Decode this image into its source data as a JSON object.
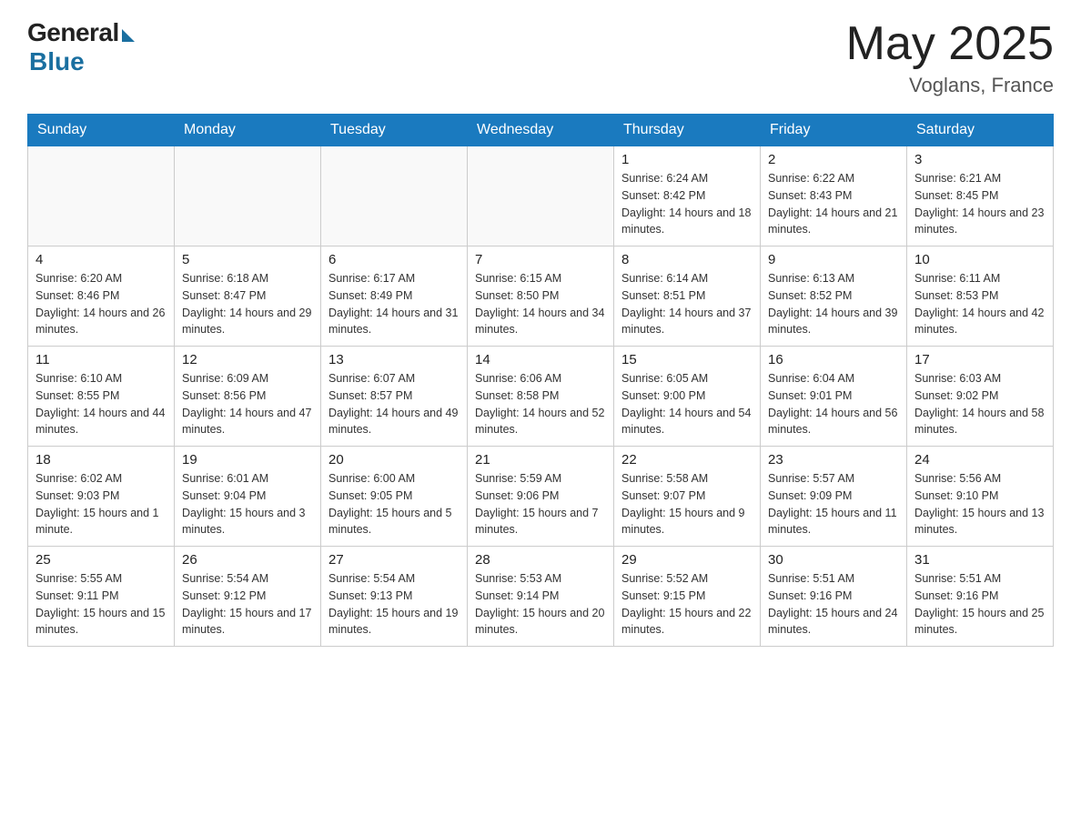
{
  "header": {
    "logo_general": "General",
    "logo_blue": "Blue",
    "month_year": "May 2025",
    "location": "Voglans, France"
  },
  "days_of_week": [
    "Sunday",
    "Monday",
    "Tuesday",
    "Wednesday",
    "Thursday",
    "Friday",
    "Saturday"
  ],
  "weeks": [
    [
      {
        "day": "",
        "info": ""
      },
      {
        "day": "",
        "info": ""
      },
      {
        "day": "",
        "info": ""
      },
      {
        "day": "",
        "info": ""
      },
      {
        "day": "1",
        "info": "Sunrise: 6:24 AM\nSunset: 8:42 PM\nDaylight: 14 hours and 18 minutes."
      },
      {
        "day": "2",
        "info": "Sunrise: 6:22 AM\nSunset: 8:43 PM\nDaylight: 14 hours and 21 minutes."
      },
      {
        "day": "3",
        "info": "Sunrise: 6:21 AM\nSunset: 8:45 PM\nDaylight: 14 hours and 23 minutes."
      }
    ],
    [
      {
        "day": "4",
        "info": "Sunrise: 6:20 AM\nSunset: 8:46 PM\nDaylight: 14 hours and 26 minutes."
      },
      {
        "day": "5",
        "info": "Sunrise: 6:18 AM\nSunset: 8:47 PM\nDaylight: 14 hours and 29 minutes."
      },
      {
        "day": "6",
        "info": "Sunrise: 6:17 AM\nSunset: 8:49 PM\nDaylight: 14 hours and 31 minutes."
      },
      {
        "day": "7",
        "info": "Sunrise: 6:15 AM\nSunset: 8:50 PM\nDaylight: 14 hours and 34 minutes."
      },
      {
        "day": "8",
        "info": "Sunrise: 6:14 AM\nSunset: 8:51 PM\nDaylight: 14 hours and 37 minutes."
      },
      {
        "day": "9",
        "info": "Sunrise: 6:13 AM\nSunset: 8:52 PM\nDaylight: 14 hours and 39 minutes."
      },
      {
        "day": "10",
        "info": "Sunrise: 6:11 AM\nSunset: 8:53 PM\nDaylight: 14 hours and 42 minutes."
      }
    ],
    [
      {
        "day": "11",
        "info": "Sunrise: 6:10 AM\nSunset: 8:55 PM\nDaylight: 14 hours and 44 minutes."
      },
      {
        "day": "12",
        "info": "Sunrise: 6:09 AM\nSunset: 8:56 PM\nDaylight: 14 hours and 47 minutes."
      },
      {
        "day": "13",
        "info": "Sunrise: 6:07 AM\nSunset: 8:57 PM\nDaylight: 14 hours and 49 minutes."
      },
      {
        "day": "14",
        "info": "Sunrise: 6:06 AM\nSunset: 8:58 PM\nDaylight: 14 hours and 52 minutes."
      },
      {
        "day": "15",
        "info": "Sunrise: 6:05 AM\nSunset: 9:00 PM\nDaylight: 14 hours and 54 minutes."
      },
      {
        "day": "16",
        "info": "Sunrise: 6:04 AM\nSunset: 9:01 PM\nDaylight: 14 hours and 56 minutes."
      },
      {
        "day": "17",
        "info": "Sunrise: 6:03 AM\nSunset: 9:02 PM\nDaylight: 14 hours and 58 minutes."
      }
    ],
    [
      {
        "day": "18",
        "info": "Sunrise: 6:02 AM\nSunset: 9:03 PM\nDaylight: 15 hours and 1 minute."
      },
      {
        "day": "19",
        "info": "Sunrise: 6:01 AM\nSunset: 9:04 PM\nDaylight: 15 hours and 3 minutes."
      },
      {
        "day": "20",
        "info": "Sunrise: 6:00 AM\nSunset: 9:05 PM\nDaylight: 15 hours and 5 minutes."
      },
      {
        "day": "21",
        "info": "Sunrise: 5:59 AM\nSunset: 9:06 PM\nDaylight: 15 hours and 7 minutes."
      },
      {
        "day": "22",
        "info": "Sunrise: 5:58 AM\nSunset: 9:07 PM\nDaylight: 15 hours and 9 minutes."
      },
      {
        "day": "23",
        "info": "Sunrise: 5:57 AM\nSunset: 9:09 PM\nDaylight: 15 hours and 11 minutes."
      },
      {
        "day": "24",
        "info": "Sunrise: 5:56 AM\nSunset: 9:10 PM\nDaylight: 15 hours and 13 minutes."
      }
    ],
    [
      {
        "day": "25",
        "info": "Sunrise: 5:55 AM\nSunset: 9:11 PM\nDaylight: 15 hours and 15 minutes."
      },
      {
        "day": "26",
        "info": "Sunrise: 5:54 AM\nSunset: 9:12 PM\nDaylight: 15 hours and 17 minutes."
      },
      {
        "day": "27",
        "info": "Sunrise: 5:54 AM\nSunset: 9:13 PM\nDaylight: 15 hours and 19 minutes."
      },
      {
        "day": "28",
        "info": "Sunrise: 5:53 AM\nSunset: 9:14 PM\nDaylight: 15 hours and 20 minutes."
      },
      {
        "day": "29",
        "info": "Sunrise: 5:52 AM\nSunset: 9:15 PM\nDaylight: 15 hours and 22 minutes."
      },
      {
        "day": "30",
        "info": "Sunrise: 5:51 AM\nSunset: 9:16 PM\nDaylight: 15 hours and 24 minutes."
      },
      {
        "day": "31",
        "info": "Sunrise: 5:51 AM\nSunset: 9:16 PM\nDaylight: 15 hours and 25 minutes."
      }
    ]
  ]
}
